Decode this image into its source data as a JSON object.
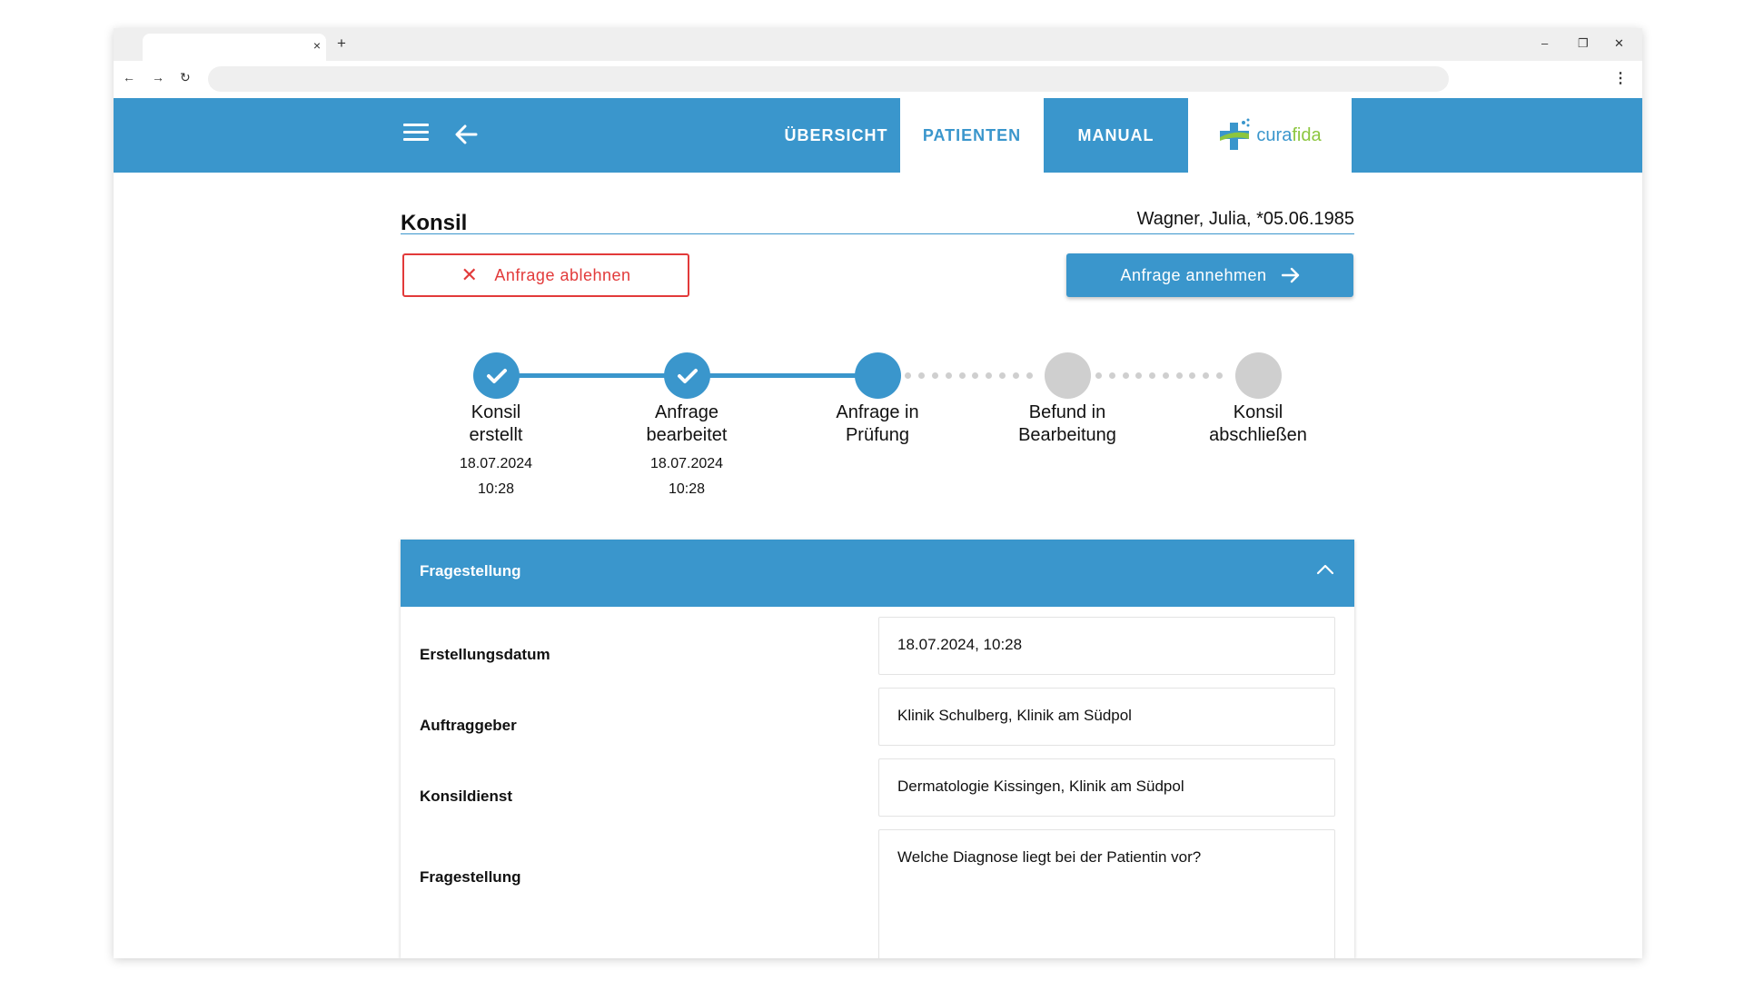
{
  "browser": {
    "tab_close": "×",
    "new_tab": "+",
    "minimize": "–",
    "restore": "❐",
    "close": "✕",
    "back": "←",
    "forward": "→",
    "reload": "↻",
    "menu": "⋮"
  },
  "nav": {
    "tabs": [
      {
        "label": "ÜBERSICHT",
        "active": false
      },
      {
        "label": "PATIENTEN",
        "active": true
      },
      {
        "label": "MANUAL",
        "active": false
      }
    ],
    "logo": {
      "part1": "cura",
      "part2": "fida"
    }
  },
  "header": {
    "title": "Konsil",
    "patient": "Wagner, Julia, *05.06.1985"
  },
  "actions": {
    "reject_label": "Anfrage ablehnen",
    "reject_icon": "✕",
    "accept_label": "Anfrage annehmen"
  },
  "steps": [
    {
      "line1": "Konsil",
      "line2": "erstellt",
      "date": "18.07.2024",
      "time": "10:28",
      "status": "done"
    },
    {
      "line1": "Anfrage",
      "line2": "bearbeitet",
      "date": "18.07.2024",
      "time": "10:28",
      "status": "done"
    },
    {
      "line1": "Anfrage in",
      "line2": "Prüfung",
      "date": "",
      "time": "",
      "status": "current"
    },
    {
      "line1": "Befund in",
      "line2": "Bearbeitung",
      "date": "",
      "time": "",
      "status": "todo"
    },
    {
      "line1": "Konsil",
      "line2": "abschließen",
      "date": "",
      "time": "",
      "status": "todo"
    }
  ],
  "panel": {
    "title": "Fragestellung",
    "fields": [
      {
        "label": "Erstellungsdatum",
        "value": "18.07.2024, 10:28"
      },
      {
        "label": "Auftraggeber",
        "value": "Klinik Schulberg, Klinik am Südpol"
      },
      {
        "label": "Konsildienst",
        "value": "Dermatologie Kissingen, Klinik am Südpol"
      },
      {
        "label": "Fragestellung",
        "value": "Welche Diagnose liegt bei der Patientin vor?"
      }
    ]
  },
  "colors": {
    "primary": "#3a96cc",
    "danger": "#e23a3a",
    "inactive": "#cfcfcf",
    "logo_green": "#8cc63f"
  }
}
